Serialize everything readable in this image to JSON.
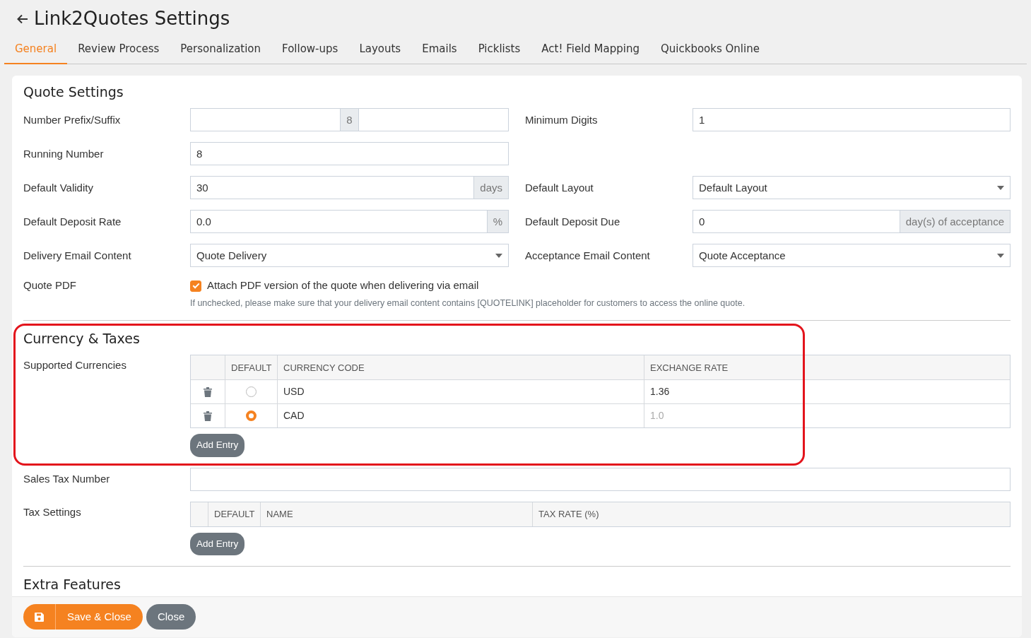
{
  "header": {
    "title": "Link2Quotes Settings"
  },
  "tabs": [
    {
      "label": "General",
      "selected": true
    },
    {
      "label": "Review Process",
      "selected": false
    },
    {
      "label": "Personalization",
      "selected": false
    },
    {
      "label": "Follow-ups",
      "selected": false
    },
    {
      "label": "Layouts",
      "selected": false
    },
    {
      "label": "Emails",
      "selected": false
    },
    {
      "label": "Picklists",
      "selected": false
    },
    {
      "label": "Act! Field Mapping",
      "selected": false
    },
    {
      "label": "Quickbooks Online",
      "selected": false
    }
  ],
  "quote_settings": {
    "title": "Quote Settings",
    "rows": [
      {
        "left": {
          "label": "Number Prefix/Suffix",
          "kind": "prefix_suffix",
          "addon": "8"
        },
        "right": {
          "label": "Minimum Digits",
          "kind": "text",
          "value": "1"
        }
      },
      {
        "left": {
          "label": "Running Number",
          "kind": "text",
          "value": "8"
        }
      },
      {
        "left": {
          "label": "Default Validity",
          "kind": "addon",
          "value": "30",
          "addon": "days"
        },
        "right": {
          "label": "Default Layout",
          "kind": "select",
          "value": "Default Layout"
        }
      },
      {
        "left": {
          "label": "Default Deposit Rate",
          "kind": "addon",
          "value": "0.0",
          "addon": "%"
        },
        "right": {
          "label": "Default Deposit Due",
          "kind": "addon",
          "value": "0",
          "addon": "day(s) of acceptance"
        }
      },
      {
        "left": {
          "label": "Delivery Email Content",
          "kind": "select",
          "value": "Quote Delivery"
        },
        "right": {
          "label": "Acceptance Email Content",
          "kind": "select",
          "value": "Quote Acceptance"
        }
      }
    ],
    "quote_pdf": {
      "label": "Quote PDF",
      "checked": true,
      "checkbox_label": "Attach PDF version of the quote when delivering via email",
      "help": "If unchecked, please make sure that your delivery email content contains [QUOTELINK] placeholder for customers to access the online quote."
    }
  },
  "currency_taxes": {
    "title": "Currency & Taxes",
    "supported_currencies": {
      "label": "Supported Currencies",
      "columns": [
        "DEFAULT",
        "CURRENCY CODE",
        "EXCHANGE RATE"
      ],
      "rows": [
        {
          "selected": false,
          "code": "USD",
          "rate": "1.36",
          "readonly": false
        },
        {
          "selected": true,
          "code": "CAD",
          "rate": "1.0",
          "readonly": true
        }
      ],
      "add_button": "Add Entry"
    },
    "sales_tax_number": {
      "label": "Sales Tax Number"
    },
    "tax_settings": {
      "label": "Tax Settings",
      "columns": [
        "DEFAULT",
        "NAME",
        "TAX RATE (%)"
      ],
      "add_button": "Add Entry"
    }
  },
  "extra_features": {
    "title": "Extra Features"
  },
  "footer": {
    "save_button": "Save & Close",
    "close_button": "Close"
  }
}
